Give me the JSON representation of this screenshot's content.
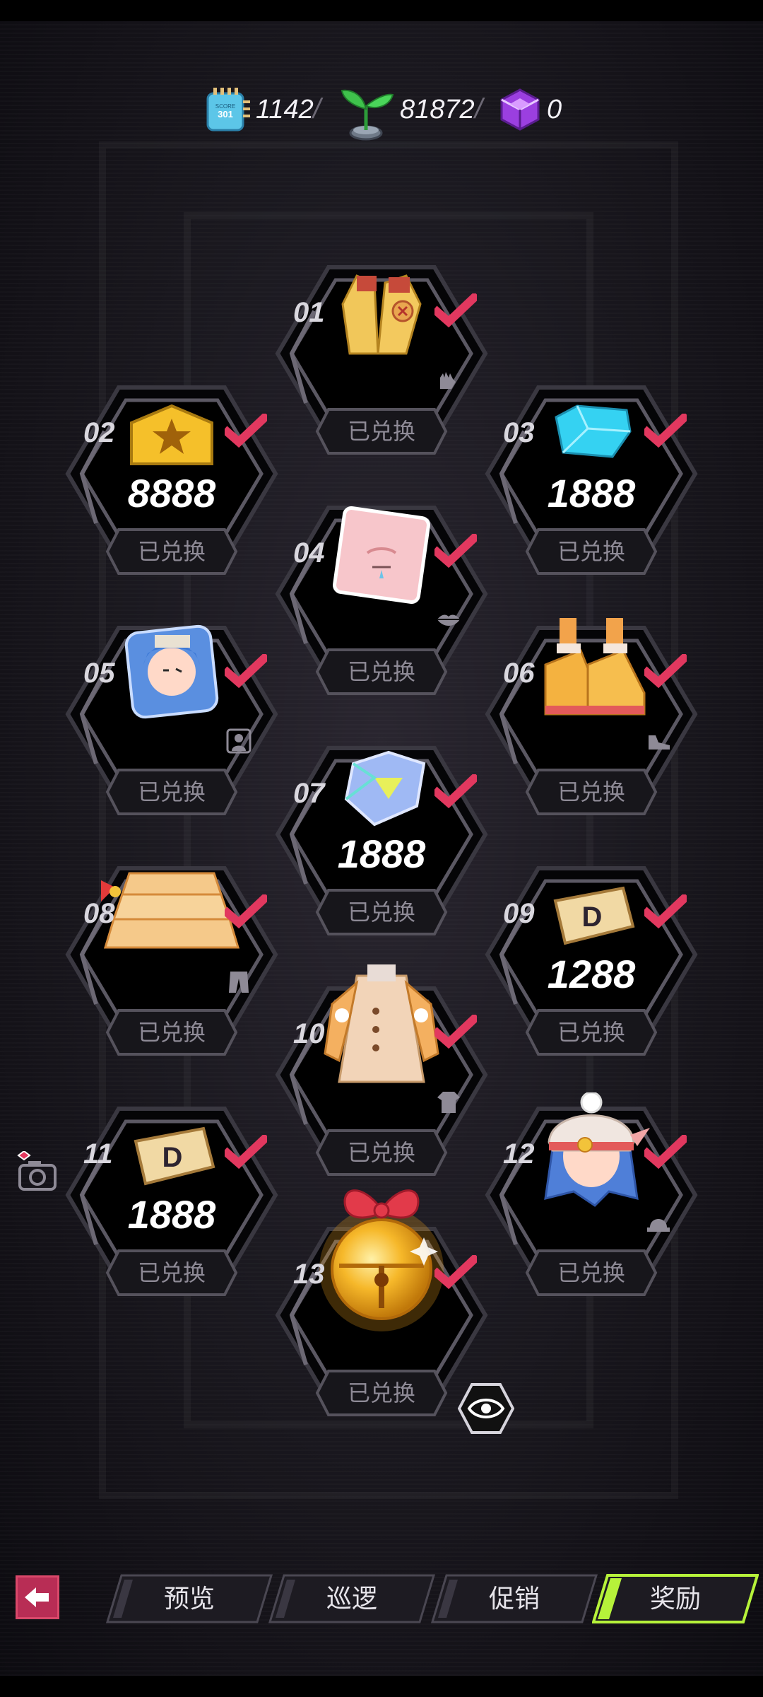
{
  "currency": {
    "coins": {
      "icon": "chip-coin-icon",
      "chip_label": "SCORE",
      "chip_number": "301",
      "value": "1142"
    },
    "sprout": {
      "icon": "sprout-icon",
      "value": "81872"
    },
    "cube": {
      "icon": "purple-cube-icon",
      "value": "0"
    },
    "separator": "/"
  },
  "rewards": [
    {
      "num": "01",
      "item": "gloves",
      "amount": "",
      "status": "已兑换",
      "claimed": true,
      "type_icon": "glove-icon"
    },
    {
      "num": "02",
      "item": "gold-badge",
      "amount": "8888",
      "status": "已兑换",
      "claimed": true,
      "type_icon": ""
    },
    {
      "num": "03",
      "item": "blue-gem",
      "amount": "1888",
      "status": "已兑换",
      "claimed": true,
      "type_icon": ""
    },
    {
      "num": "04",
      "item": "face-sticker",
      "amount": "",
      "status": "已兑换",
      "claimed": true,
      "type_icon": "lips-icon"
    },
    {
      "num": "05",
      "item": "avatar-frame",
      "amount": "",
      "status": "已兑换",
      "claimed": true,
      "type_icon": "portrait-icon"
    },
    {
      "num": "06",
      "item": "sneakers",
      "amount": "",
      "status": "已兑换",
      "claimed": true,
      "type_icon": "shoe-icon"
    },
    {
      "num": "07",
      "item": "holo-gem",
      "amount": "1888",
      "status": "已兑换",
      "claimed": true,
      "type_icon": ""
    },
    {
      "num": "08",
      "item": "ruffle-skirt",
      "amount": "",
      "status": "已兑换",
      "claimed": true,
      "type_icon": "pants-icon"
    },
    {
      "num": "09",
      "item": "d-ticket",
      "amount": "1288",
      "status": "已兑换",
      "claimed": true,
      "type_icon": ""
    },
    {
      "num": "10",
      "item": "coat",
      "amount": "",
      "status": "已兑换",
      "claimed": true,
      "type_icon": "shirt-icon"
    },
    {
      "num": "11",
      "item": "d-ticket",
      "amount": "1888",
      "status": "已兑换",
      "claimed": true,
      "type_icon": ""
    },
    {
      "num": "12",
      "item": "beanie-hair",
      "amount": "",
      "status": "已兑换",
      "claimed": true,
      "type_icon": "hat-icon"
    },
    {
      "num": "13",
      "item": "golden-bell",
      "amount": "",
      "status": "已兑换",
      "claimed": true,
      "type_icon": ""
    }
  ],
  "tabs": [
    {
      "label": "预览",
      "active": false
    },
    {
      "label": "巡逻",
      "active": false
    },
    {
      "label": "促销",
      "active": false
    },
    {
      "label": "奖励",
      "active": true
    }
  ],
  "colors": {
    "accent_green": "#b6f23a",
    "check_red": "#e2385f",
    "back_pink": "#b82d55"
  }
}
